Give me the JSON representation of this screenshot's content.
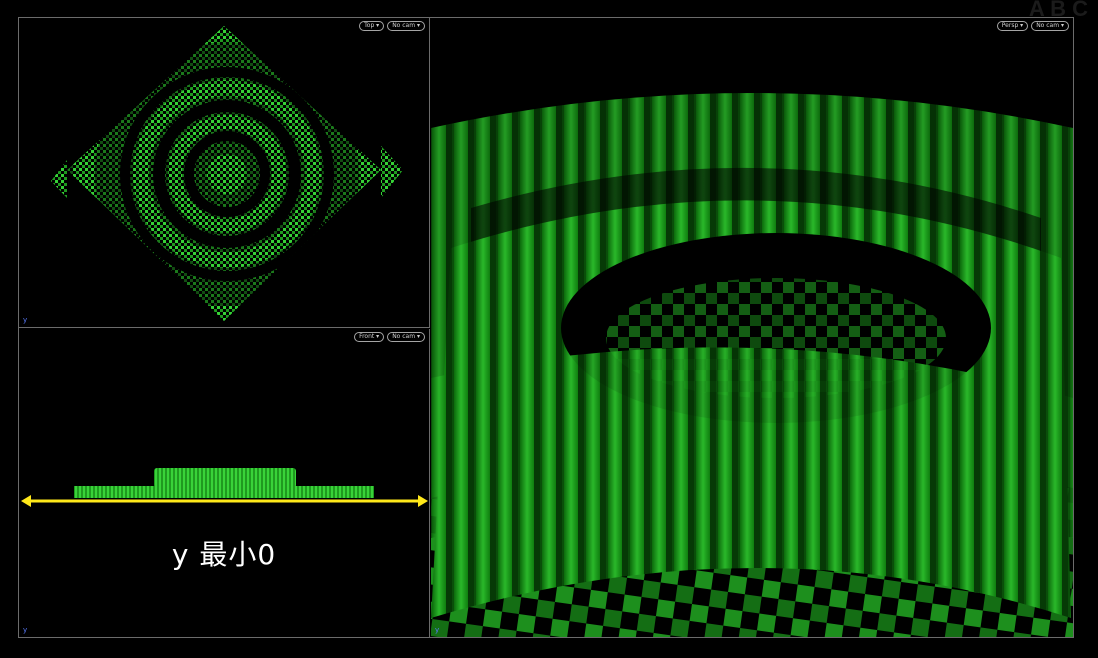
{
  "viewports": {
    "top": {
      "view_button": "Top ▾",
      "camera_button": "No cam ▾"
    },
    "front": {
      "view_button": "Front ▾",
      "camera_button": "No cam ▾"
    },
    "persp": {
      "view_button": "Persp ▾",
      "camera_button": "No cam ▾"
    }
  },
  "annotation": {
    "caption": "y 最小0"
  },
  "axis_indicator": "y",
  "colors": {
    "accent": "#2fd42f",
    "dark_green": "#0f6b0f",
    "line": "#ffe81a",
    "border": "#6b6b6b"
  },
  "watermark": "A B C"
}
